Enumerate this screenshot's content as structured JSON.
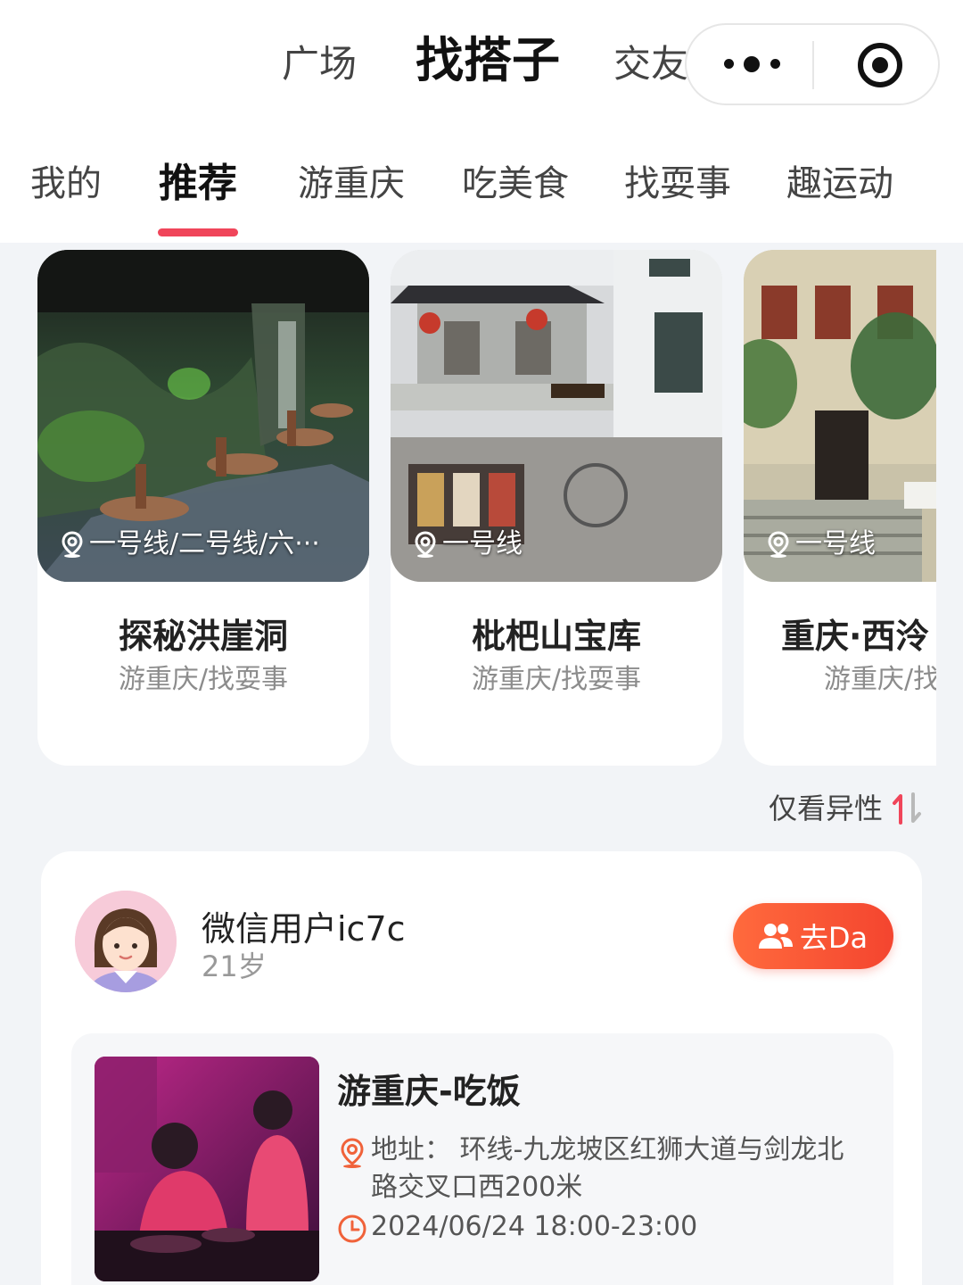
{
  "top_tabs": [
    {
      "label": "广场"
    },
    {
      "label": "找搭子"
    },
    {
      "label": "交友"
    }
  ],
  "categories": [
    {
      "label": "我的"
    },
    {
      "label": "推荐"
    },
    {
      "label": "游重庆"
    },
    {
      "label": "吃美食"
    },
    {
      "label": "找耍事"
    },
    {
      "label": "趣运动"
    }
  ],
  "cards": [
    {
      "location": "一号线/二号线/六···",
      "title": "探秘洪崖洞",
      "tags": "游重庆/找耍事"
    },
    {
      "location": "一号线",
      "title": "枇杷山宝库",
      "tags": "游重庆/找耍事"
    },
    {
      "location": "一号线",
      "title": "重庆·西泠",
      "tags": "游重庆/找"
    }
  ],
  "filter": {
    "label": "仅看异性"
  },
  "post": {
    "username": "微信用户ic7c",
    "age": "21岁",
    "join_label": "去Da",
    "activity": {
      "title": "游重庆-吃饭",
      "address": "地址：  环线-九龙坡区红狮大道与剑龙北路交叉口西200米",
      "time": "2024/06/24 18:00-23:00"
    }
  },
  "colors": {
    "accent": "#f0455a",
    "button": "#f4452f",
    "icon_orange": "#f0623a"
  }
}
